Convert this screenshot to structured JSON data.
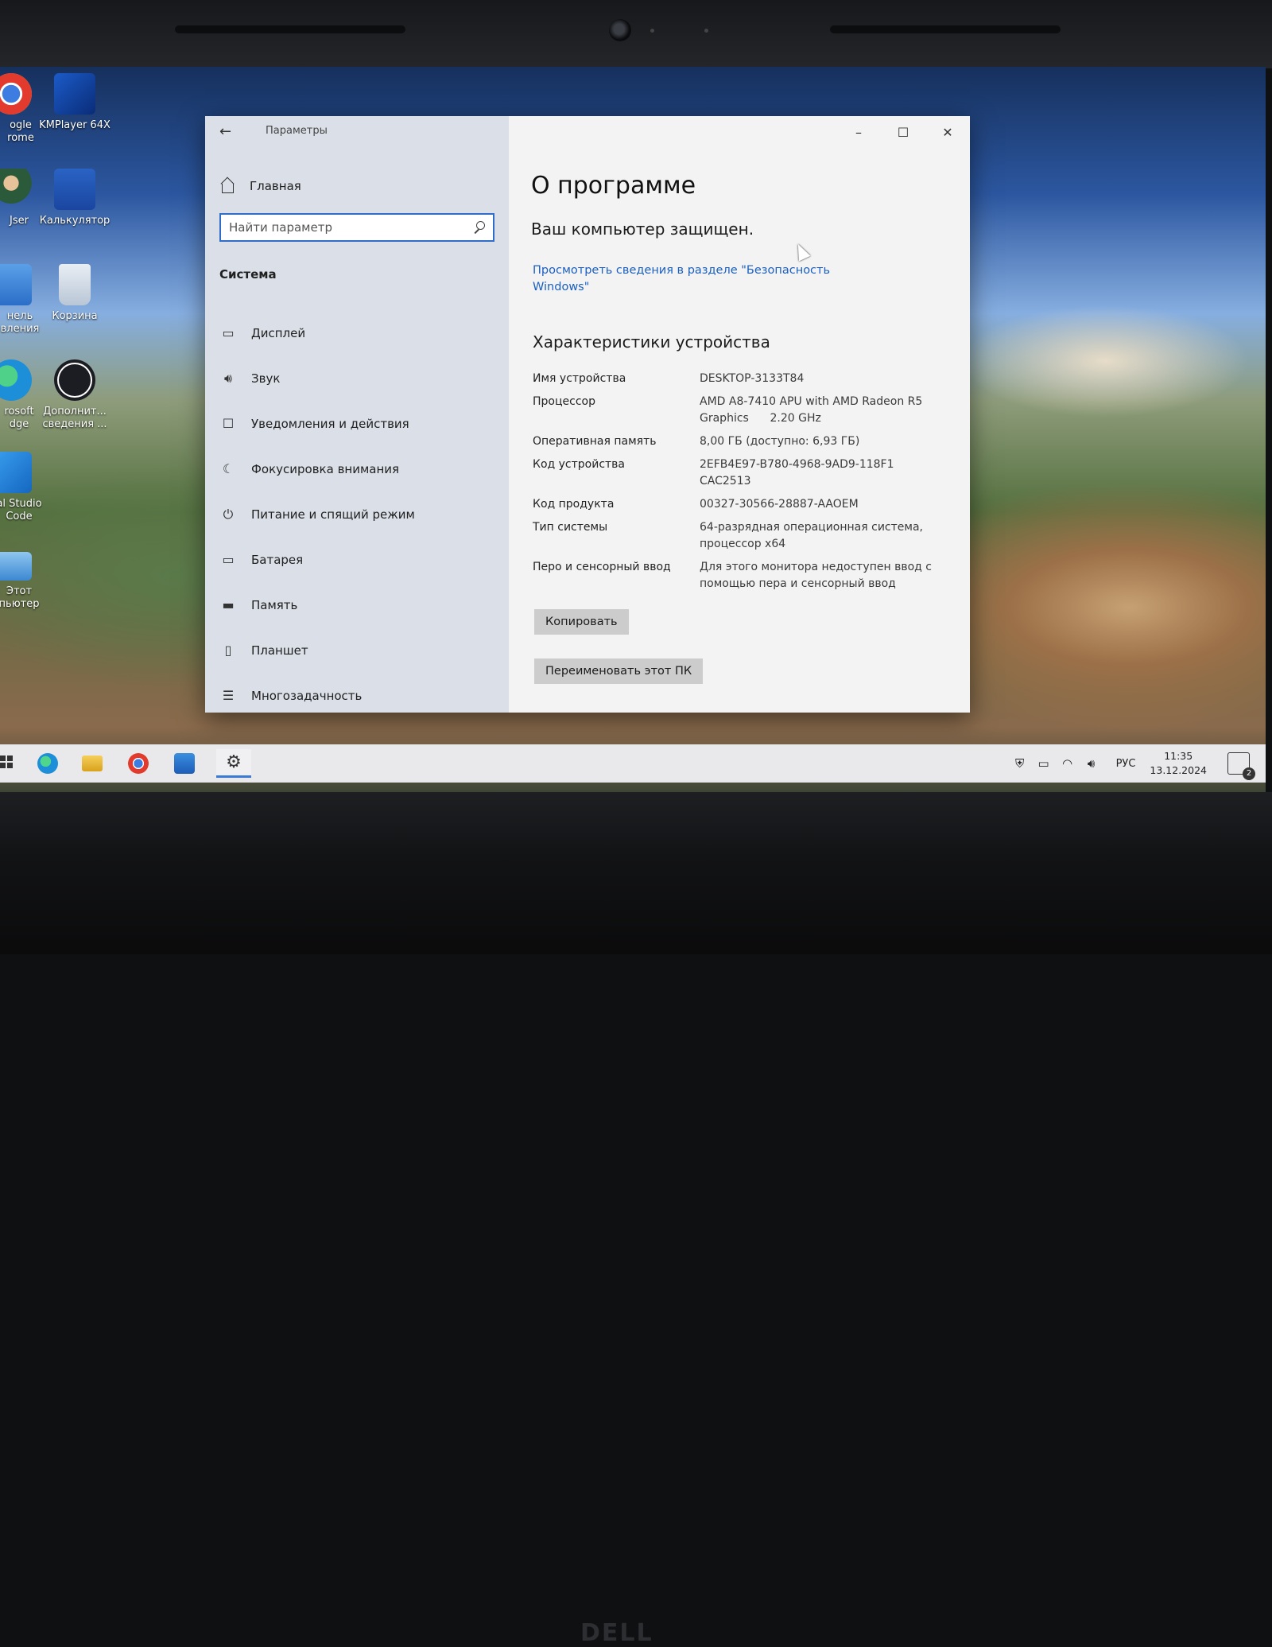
{
  "desktop": {
    "icons": [
      {
        "label": "ogle\nrome"
      },
      {
        "label": "KMPlayer 64X"
      },
      {
        "label": "Jser"
      },
      {
        "label": "Калькулятор"
      },
      {
        "label": "нель\nвления"
      },
      {
        "label": "Корзина"
      },
      {
        "label": "rosoft\ndge"
      },
      {
        "label": "Дополнит... сведения ..."
      },
      {
        "label": "al Studio\nCode"
      },
      {
        "label": "Этот\nпьютер"
      }
    ]
  },
  "window": {
    "app_title": "Параметры",
    "home_label": "Главная",
    "search_placeholder": "Найти параметр",
    "section_title": "Система",
    "nav": [
      {
        "label": "Дисплей",
        "icon": "display-icon"
      },
      {
        "label": "Звук",
        "icon": "speaker-icon"
      },
      {
        "label": "Уведомления и действия",
        "icon": "notification-icon"
      },
      {
        "label": "Фокусировка внимания",
        "icon": "moon-icon"
      },
      {
        "label": "Питание и спящий режим",
        "icon": "power-icon"
      },
      {
        "label": "Батарея",
        "icon": "battery-icon"
      },
      {
        "label": "Память",
        "icon": "storage-icon"
      },
      {
        "label": "Планшет",
        "icon": "tablet-icon"
      },
      {
        "label": "Многозадачность",
        "icon": "multitask-icon"
      }
    ],
    "page_title": "О программе",
    "protected_text": "Ваш компьютер защищен.",
    "security_link": "Просмотреть сведения в разделе \"Безопасность Windows\"",
    "specs_title": "Характеристики устройства",
    "specs": [
      {
        "key": "Имя устройства",
        "value": "DESKTOP-3133T84"
      },
      {
        "key": "Процессор",
        "value": "AMD A8-7410 APU with AMD Radeon R5 Graphics      2.20 GHz"
      },
      {
        "key": "Оперативная память",
        "value": "8,00 ГБ (доступно: 6,93 ГБ)"
      },
      {
        "key": "Код устройства",
        "value": "2EFB4E97-B780-4968-9AD9-118F1CAC2513"
      },
      {
        "key": "Код продукта",
        "value": "00327-30566-28887-AAOEM"
      },
      {
        "key": "Тип системы",
        "value": "64-разрядная операционная система, процессор x64"
      },
      {
        "key": "Перо и сенсорный ввод",
        "value": "Для этого монитора недоступен ввод с помощью пера и сенсорный ввод"
      }
    ],
    "copy_button": "Копировать",
    "rename_button": "Переименовать этот ПК"
  },
  "taskbar": {
    "language": "РУС",
    "time": "11:35",
    "date": "13.12.2024",
    "notification_count": "2"
  },
  "bezel": {
    "brand": "DELL"
  },
  "colors": {
    "link": "#1a5fc0",
    "accent": "#2f6dc8",
    "sidebar_bg": "#dbe0e8"
  }
}
